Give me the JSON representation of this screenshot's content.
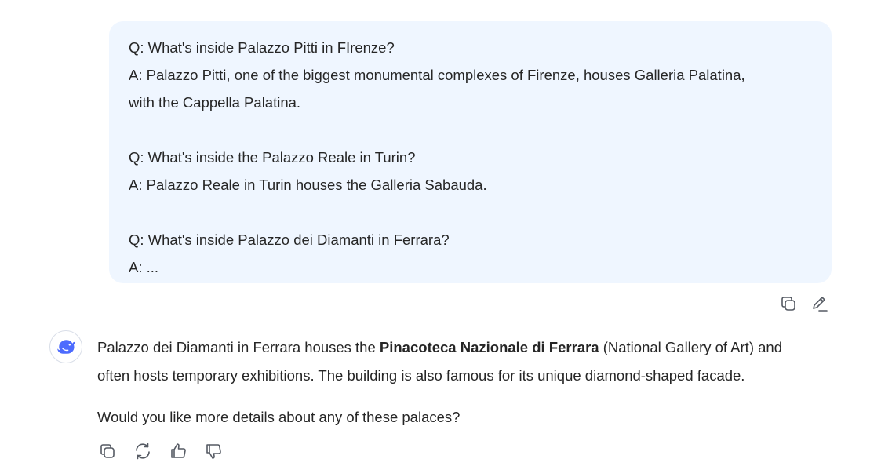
{
  "user_message": {
    "lines": [
      "Q: What's inside Palazzo Pitti in FIrenze?",
      "A: Palazzo Pitti, one of the biggest monumental complexes of Firenze, houses Galleria Palatina,",
      "with the Cappella Palatina.",
      "",
      "Q: What's inside the Palazzo Reale in Turin?",
      "A: Palazzo Reale in Turin houses the Galleria Sabauda.",
      "",
      "Q: What's inside Palazzo dei Diamanti in Ferrara?",
      "A: ..."
    ],
    "actions": {
      "copy_icon": "copy-icon",
      "edit_icon": "edit-icon"
    }
  },
  "assistant_message": {
    "avatar_icon": "whale-logo-icon",
    "para1_line1_before": "Palazzo dei Diamanti in Ferrara houses the ",
    "para1_line1_bold": "Pinacoteca Nazionale di Ferrara",
    "para1_line1_after": " (National Gallery of Art) and",
    "para1_line2": "often hosts temporary exhibitions. The building is also famous for its unique diamond-shaped facade.",
    "para2": "Would you like more details about any of these palaces?",
    "actions": [
      "copy-icon",
      "regenerate-icon",
      "thumbs-up-icon",
      "thumbs-down-icon"
    ]
  },
  "colors": {
    "bubble_bg": "#eff6ff",
    "text": "#262626",
    "icon": "#555a63",
    "brand": "#4d6bfe"
  }
}
